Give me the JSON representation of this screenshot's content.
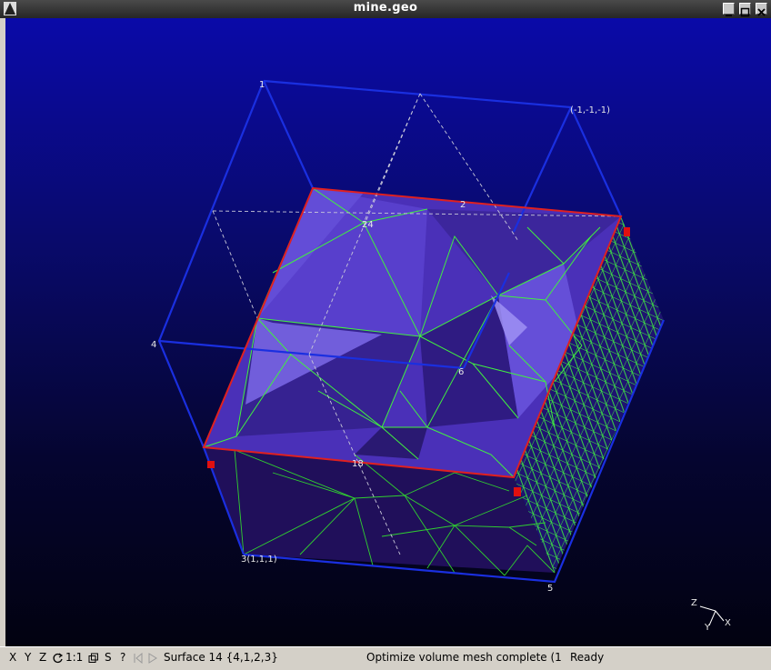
{
  "window": {
    "title": "mine.geo"
  },
  "viewport": {
    "point_labels": [
      "1",
      "(-1,-1,-1)",
      "2",
      "24",
      "4",
      "6",
      "18",
      "3(1,1,1)",
      "5"
    ],
    "axes": {
      "z": "Z",
      "y": "Y",
      "x": "X"
    }
  },
  "statusbar": {
    "buttons": [
      "X",
      "Y",
      "Z",
      "1:1",
      "S",
      "?"
    ],
    "surface_info": "Surface 14 {4,1,2,3}",
    "message": "Optimize volume mesh complete (1",
    "state": "Ready"
  },
  "colors": {
    "edge_blue": "#1a2fe0",
    "edge_red": "#e02020",
    "mesh_green": "#40f040",
    "face_purple": "#4b2fb8"
  }
}
